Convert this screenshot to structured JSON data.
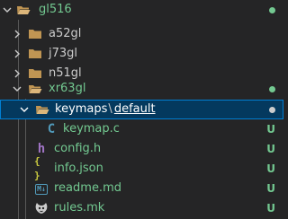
{
  "tree": {
    "root": {
      "label": "gl516"
    },
    "folders": [
      {
        "label": "a52gl"
      },
      {
        "label": "j73gl"
      },
      {
        "label": "n51gl"
      },
      {
        "label": "xr63gl"
      }
    ],
    "selected": {
      "folder": "keymaps",
      "separator": "\\",
      "subfolder": "default"
    },
    "files": [
      {
        "label": "keymap.c",
        "icon": "C",
        "status": "U"
      },
      {
        "label": "config.h",
        "icon": "h",
        "status": "U"
      },
      {
        "label": "info.json",
        "icon": "{ }",
        "status": "U"
      },
      {
        "label": "readme.md",
        "icon": "M↓",
        "status": "U"
      },
      {
        "label": "rules.mk",
        "status": "U"
      }
    ]
  },
  "colors": {
    "background": "#252526",
    "selected_background": "#04395e",
    "selected_border": "#007fd4",
    "untracked_green": "#73c991",
    "folder_brown": "#c09553"
  }
}
